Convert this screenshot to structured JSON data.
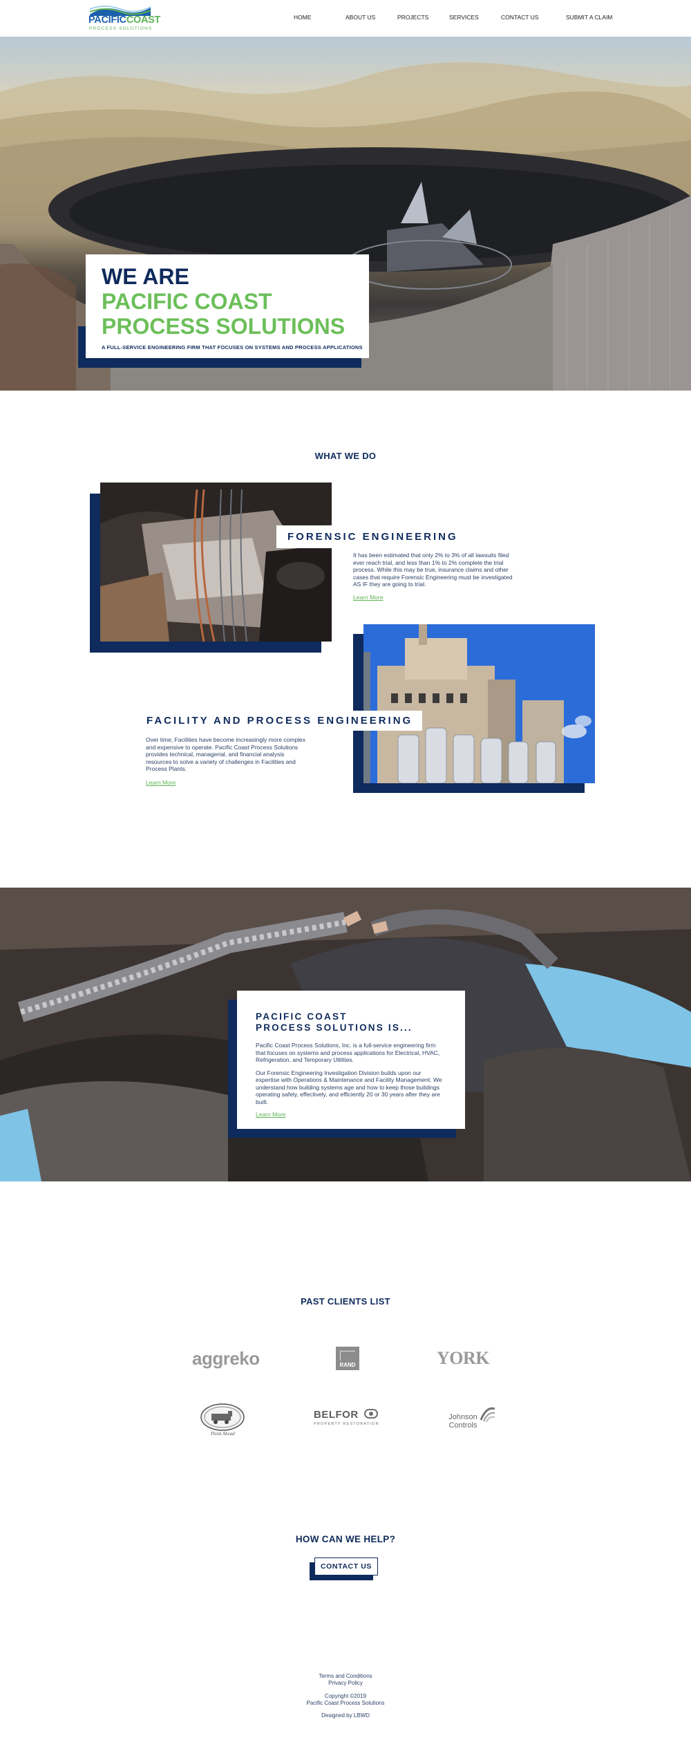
{
  "header": {
    "logo": {
      "word_a": "PACIFIC",
      "word_b": "COAST",
      "sub": "PROCESS SOLUTIONS"
    },
    "nav": [
      {
        "label": "HOME"
      },
      {
        "label": "ABOUT US"
      },
      {
        "label": "PROJECTS"
      },
      {
        "label": "SERVICES"
      },
      {
        "label": "CONTACT US"
      },
      {
        "label": "SUBMIT A CLAIM"
      }
    ]
  },
  "hero": {
    "line1": "WE ARE",
    "line2": "PACIFIC COAST",
    "line3": "PROCESS SOLUTIONS",
    "tagline": "A FULL-SERVICE ENGINEERING FIRM THAT FOCUSES ON SYSTEMS AND PROCESS APPLICATIONS"
  },
  "what_we_do": {
    "title": "WHAT WE DO",
    "forensic": {
      "title": "FORENSIC ENGINEERING",
      "text": "It has been estimated that only 2% to 3% of all lawsuits filed ever reach trial, and less than 1% to 2% complete the trial process. While this may be true, insurance claims and other cases that require Forensic Engineering must be investigated AS IF they are going to trial.",
      "link": "Learn More"
    },
    "facility": {
      "title": "FACILITY AND PROCESS ENGINEERING",
      "text": "Over time, Facilities have become increasingly more complex and expensive to operate. Pacific Coast Process Solutions provides technical, managerial, and financial analysis resources to solve a variety of challenges in Facilities and Process Plants.",
      "link": "Learn More"
    }
  },
  "about": {
    "title_1": "PACIFIC COAST",
    "title_2": "PROCESS SOLUTIONS IS...",
    "p1": "Pacific Coast Process Solutions, Inc. is a full-service engineering firm that focuses on systems and process applications for Electrical, HVAC, Refrigeration, and Temporary Utilities.",
    "p2": "Our Forensic Engineering Investigation Division builds upon our expertise with Operations & Maintenance and Facility Management. We understand how building systems age and how to keep those buildings operating safely, effectively, and efficiently 20 or 30 years after they are built.",
    "link": "Learn More"
  },
  "clients": {
    "title": "PAST CLIENTS LIST",
    "aggreko": "aggreko",
    "rand": "RAND",
    "york": "YORK",
    "think_ahead": "Think Ahead",
    "belfor": "BELFOR",
    "belfor_sub": "PROPERTY RESTORATION",
    "johnson_1": "Johnson",
    "johnson_2": "Controls"
  },
  "help": {
    "title": "HOW CAN WE HELP?",
    "button": "CONTACT US"
  },
  "footer": {
    "terms": "Terms and Conditions",
    "privacy": "Privacy Policy",
    "copyright": "Copyright ©2019",
    "company": "Pacific Coast Process Solutions",
    "designed": "Designed by LBWD"
  }
}
